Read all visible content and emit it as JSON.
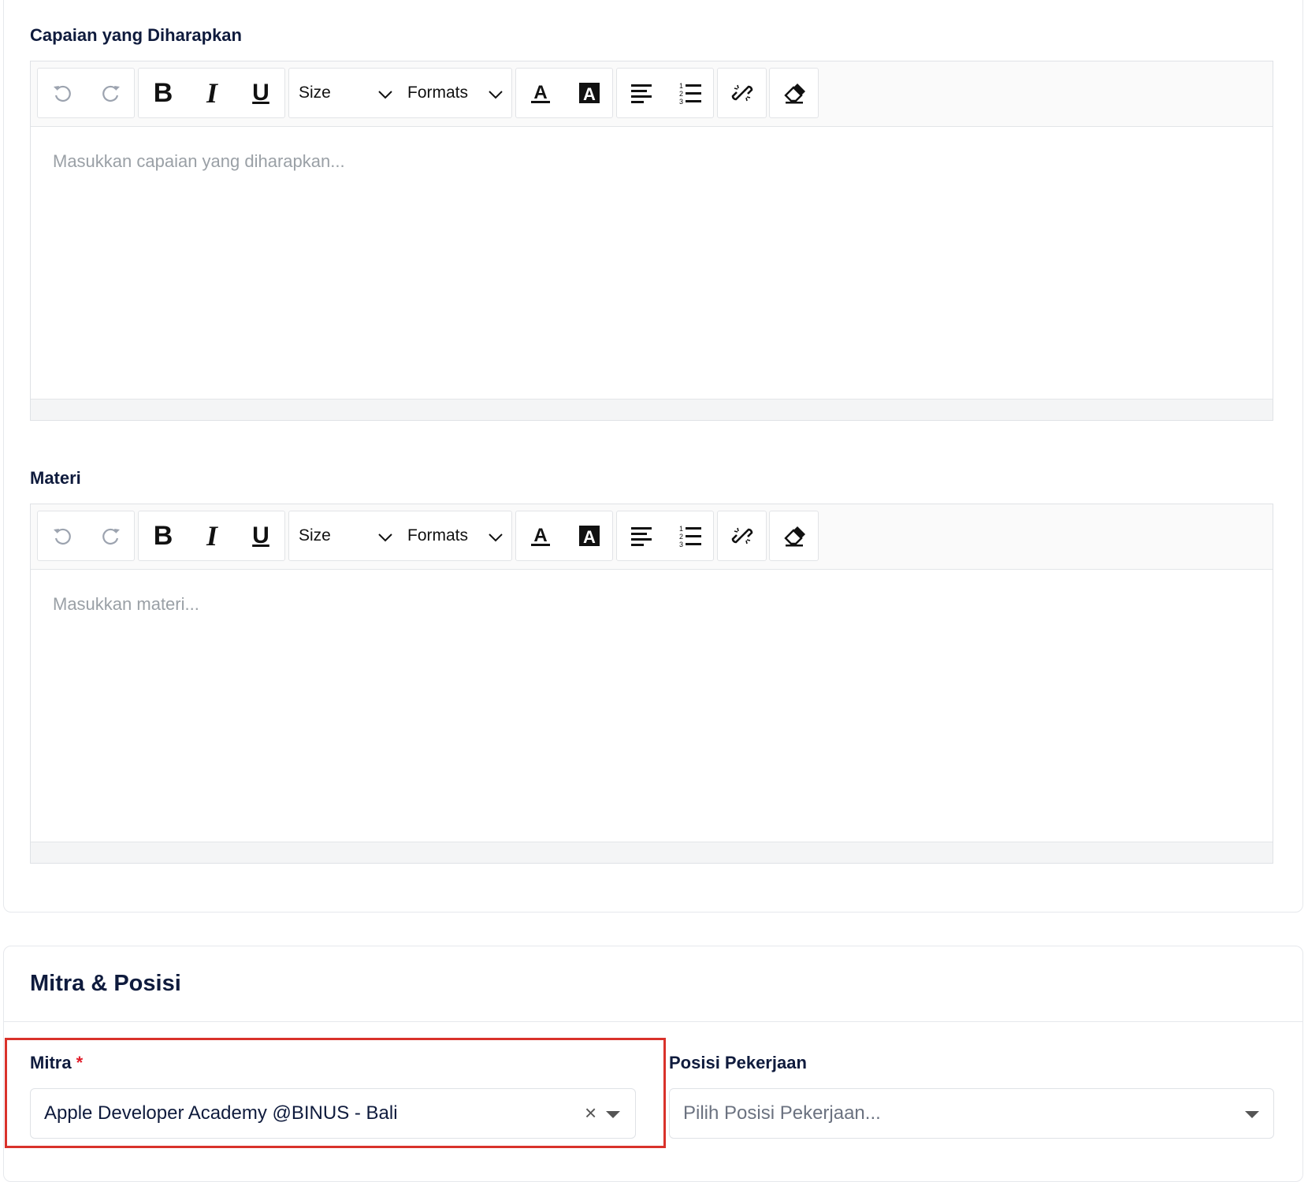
{
  "sections": {
    "capaian": {
      "label": "Capaian yang Diharapkan",
      "placeholder": "Masukkan capaian yang diharapkan..."
    },
    "materi": {
      "label": "Materi",
      "placeholder": "Masukkan materi..."
    },
    "mitra_posisi": {
      "title": "Mitra & Posisi",
      "mitra": {
        "label": "Mitra",
        "required_mark": "*",
        "selected_value": "Apple Developer Academy @BINUS - Bali",
        "clear_glyph": "×"
      },
      "posisi": {
        "label": "Posisi Pekerjaan",
        "placeholder": "Pilih Posisi Pekerjaan..."
      }
    }
  },
  "toolbar": {
    "size_label": "Size",
    "formats_label": "Formats",
    "buttons": [
      "undo-icon",
      "redo-icon",
      "bold-icon",
      "italic-icon",
      "underline-icon",
      "font-color-icon",
      "background-color-icon",
      "align-left-icon",
      "numbered-list-icon",
      "link-icon",
      "eraser-icon"
    ]
  },
  "colors": {
    "label_navy": "#0f1b3d",
    "placeholder_gray": "#9aa0a6",
    "required_red": "#e11d2a",
    "highlight_red": "#d9322b"
  }
}
